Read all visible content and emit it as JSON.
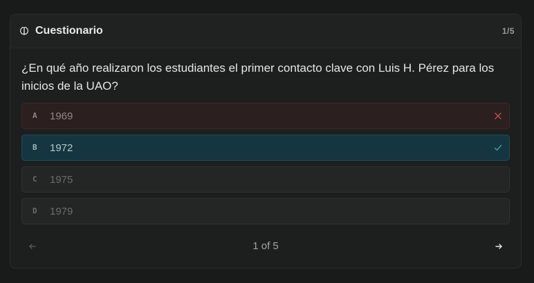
{
  "header": {
    "title": "Cuestionario",
    "count": "1/5",
    "icon": "brain-icon"
  },
  "question": "¿En qué año realizaron los estudiantes el primer contacto clave con Luis H. Pérez para los inicios de la UAO?",
  "options": [
    {
      "letter": "A",
      "value": "1969",
      "state": "incorrect",
      "icon": "x-icon"
    },
    {
      "letter": "B",
      "value": "1972",
      "state": "correct",
      "icon": "check-icon"
    },
    {
      "letter": "C",
      "value": "1975",
      "state": "neutral"
    },
    {
      "letter": "D",
      "value": "1979",
      "state": "neutral"
    }
  ],
  "pagination": {
    "label": "1 of 5",
    "prev_icon": "arrow-left-icon",
    "next_icon": "arrow-right-icon"
  },
  "colors": {
    "background": "#191a1a",
    "correct": "#2aa8a0",
    "incorrect": "#c0504d"
  }
}
